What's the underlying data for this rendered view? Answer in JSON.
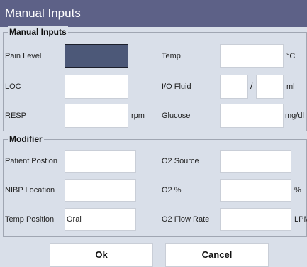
{
  "window": {
    "title": "Manual Inputs"
  },
  "manual_inputs": {
    "group_title": "Manual Inputs",
    "pain_level_label": "Pain Level",
    "pain_level_value": "",
    "temp_label": "Temp",
    "temp_value": "",
    "temp_unit": "°C",
    "loc_label": "LOC",
    "loc_value": "",
    "io_fluid_label": "I/O Fluid",
    "io_in_value": "",
    "io_separator": "/",
    "io_out_value": "",
    "io_unit": "ml",
    "resp_label": "RESP",
    "resp_value": "",
    "resp_unit": "rpm",
    "glucose_label": "Glucose",
    "glucose_value": "",
    "glucose_unit": "mg/dl"
  },
  "modifier": {
    "group_title": "Modifier",
    "patient_position_label": "Patient Postion",
    "patient_position_value": "",
    "o2_source_label": "O2 Source",
    "o2_source_value": "",
    "nibp_location_label": "NIBP Location",
    "nibp_location_value": "",
    "o2_percent_label": "O2 %",
    "o2_percent_value": "",
    "o2_percent_unit": "%",
    "temp_position_label": "Temp Position",
    "temp_position_value": "Oral",
    "o2_flow_rate_label": "O2 Flow Rate",
    "o2_flow_rate_value": "",
    "o2_flow_rate_unit": "LPM"
  },
  "buttons": {
    "ok": "Ok",
    "cancel": "Cancel"
  },
  "colors": {
    "titlebar": "#5d6187",
    "background": "#d9dfe9",
    "focused_field": "#4c5878"
  }
}
